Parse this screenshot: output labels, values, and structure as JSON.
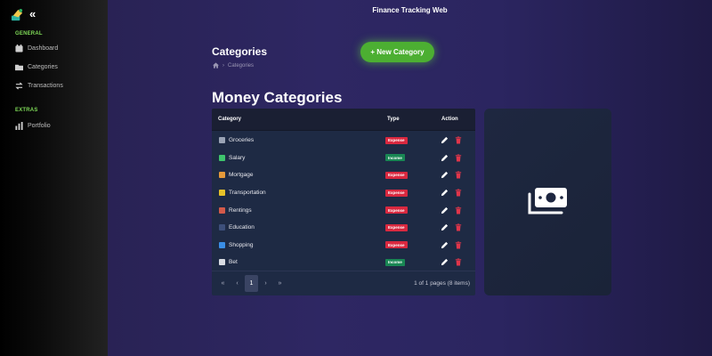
{
  "app": {
    "title": "Finance Tracking Web"
  },
  "sidebar": {
    "collapse_label": "«",
    "sections": [
      {
        "label": "GENERAL",
        "items": [
          {
            "label": "Dashboard",
            "icon": "calendar-icon"
          },
          {
            "label": "Categories",
            "icon": "folder-icon"
          },
          {
            "label": "Transactions",
            "icon": "exchange-icon"
          }
        ]
      },
      {
        "label": "EXTRAS",
        "items": [
          {
            "label": "Portfolio",
            "icon": "bar-chart-icon"
          }
        ]
      }
    ]
  },
  "page": {
    "title": "Categories",
    "breadcrumb": "Categories",
    "new_button": "+ New Category",
    "section_title": "Money Categories"
  },
  "table": {
    "headers": {
      "category": "Category",
      "type": "Type",
      "action": "Action"
    },
    "rows": [
      {
        "name": "Groceries",
        "type": "Expense",
        "icon": "cart-icon",
        "icon_color": "#9aa3b5"
      },
      {
        "name": "Salary",
        "type": "Income",
        "icon": "money-icon",
        "icon_color": "#3ec46d"
      },
      {
        "name": "Mortgage",
        "type": "Expense",
        "icon": "house-icon",
        "icon_color": "#e59a3a"
      },
      {
        "name": "Transportation",
        "type": "Expense",
        "icon": "bus-icon",
        "icon_color": "#e6c229"
      },
      {
        "name": "Rentings",
        "type": "Expense",
        "icon": "home-icon",
        "icon_color": "#d35a4a"
      },
      {
        "name": "Education",
        "type": "Expense",
        "icon": "school-icon",
        "icon_color": "#3d4f7a"
      },
      {
        "name": "Shopping",
        "type": "Expense",
        "icon": "shopping-bags-icon",
        "icon_color": "#3a8ee6"
      },
      {
        "name": "Bet",
        "type": "Income",
        "icon": "dice-icon",
        "icon_color": "#d8dbe2"
      }
    ],
    "pagination": {
      "first": "«",
      "prev": "‹",
      "current": "1",
      "next": "›",
      "last": "»",
      "info": "1 of 1 pages (8 items)"
    }
  },
  "colors": {
    "accent_green": "#4caf32",
    "expense_badge": "#d9283f",
    "income_badge": "#198754",
    "delete_icon": "#e0354a"
  }
}
